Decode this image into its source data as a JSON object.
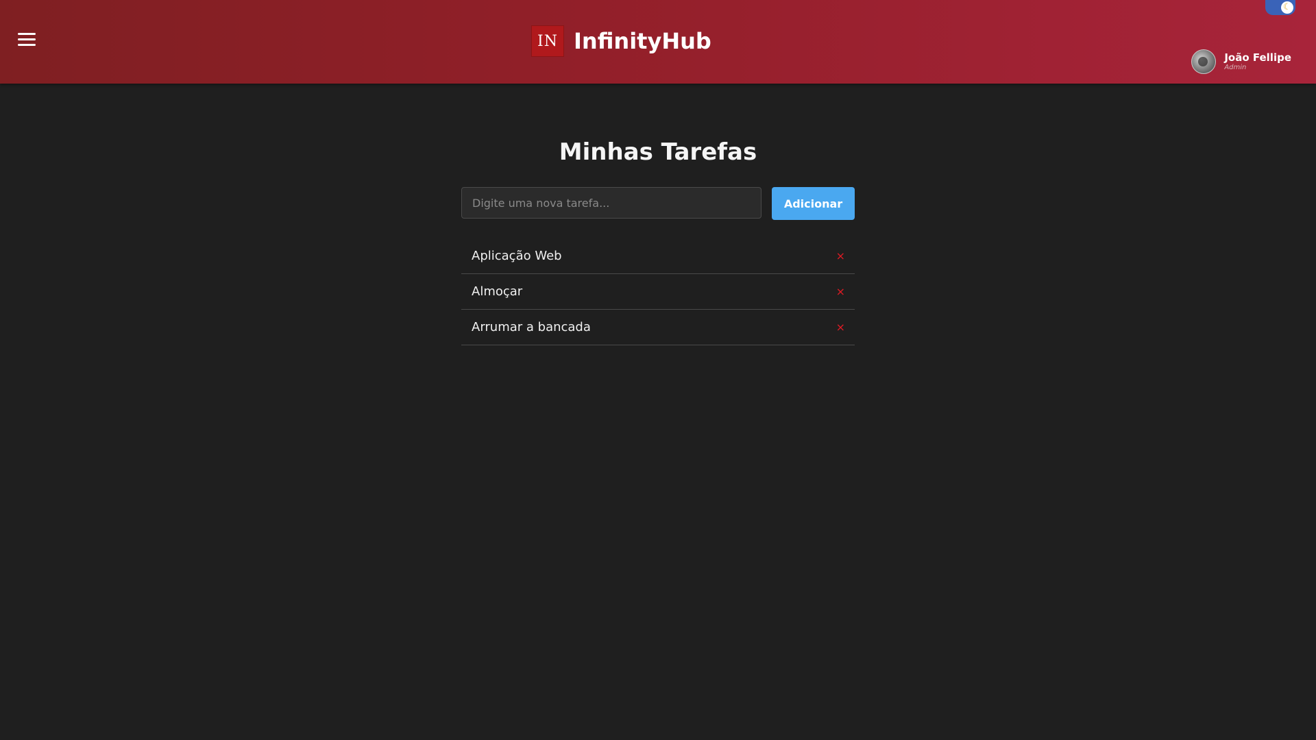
{
  "header": {
    "menu_icon": "hamburger-menu-icon",
    "logo_text": "IN",
    "brand_name": "InfinityHub",
    "theme_toggle_icon": "moon-icon",
    "theme_toggle_glyph": "☾",
    "user": {
      "name": "João Fellipe",
      "role": "Admin"
    },
    "colors": {
      "gradient_start": "#7f1f22",
      "gradient_end": "#a8243a",
      "logo_bg": "#b0191c"
    }
  },
  "main": {
    "title": "Minhas Tarefas",
    "input": {
      "value": "",
      "placeholder": "Digite uma nova tarefa..."
    },
    "add_button_label": "Adicionar",
    "tasks": [
      {
        "label": "Aplicação Web",
        "delete_glyph": "×"
      },
      {
        "label": "Almoçar",
        "delete_glyph": "×"
      },
      {
        "label": "Arrumar a bancada",
        "delete_glyph": "×"
      }
    ],
    "colors": {
      "background": "#1f1f1f",
      "accent": "#4aa8f0",
      "delete": "#e01b24"
    }
  }
}
